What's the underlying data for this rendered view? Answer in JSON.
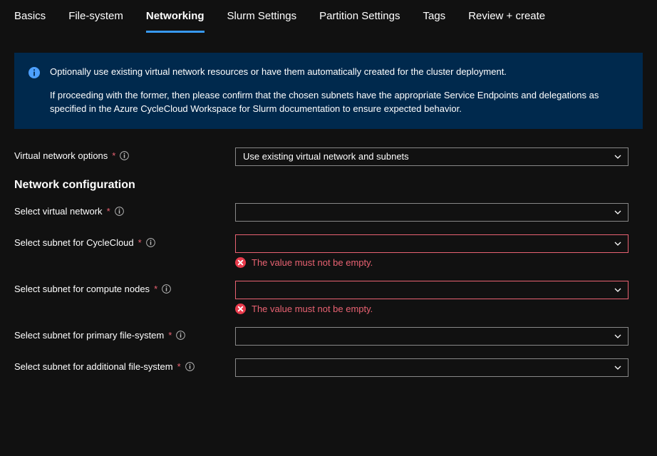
{
  "tabs": [
    {
      "label": "Basics"
    },
    {
      "label": "File-system"
    },
    {
      "label": "Networking"
    },
    {
      "label": "Slurm Settings"
    },
    {
      "label": "Partition Settings"
    },
    {
      "label": "Tags"
    },
    {
      "label": "Review + create"
    }
  ],
  "active_tab_index": 2,
  "banner": {
    "line1": "Optionally use existing virtual network resources or have them automatically created for the cluster deployment.",
    "line2": "If proceeding with the former, then please confirm that the chosen subnets have the appropriate Service Endpoints and delegations as specified in the Azure CycleCloud Workspace for Slurm documentation to ensure expected behavior."
  },
  "vnet_options": {
    "label": "Virtual network options",
    "value": "Use existing virtual network and subnets"
  },
  "section_title": "Network configuration",
  "fields": {
    "select_vnet": {
      "label": "Select virtual network",
      "value": "",
      "error": ""
    },
    "subnet_cyclecloud": {
      "label": "Select subnet for CycleCloud",
      "value": "",
      "error": "The value must not be empty."
    },
    "subnet_compute": {
      "label": "Select subnet for compute nodes",
      "value": "",
      "error": "The value must not be empty."
    },
    "subnet_primary_fs": {
      "label": "Select subnet for primary file-system",
      "value": "",
      "error": ""
    },
    "subnet_additional_fs": {
      "label": "Select subnet for additional file-system",
      "value": "",
      "error": ""
    }
  },
  "required_marker": "*"
}
